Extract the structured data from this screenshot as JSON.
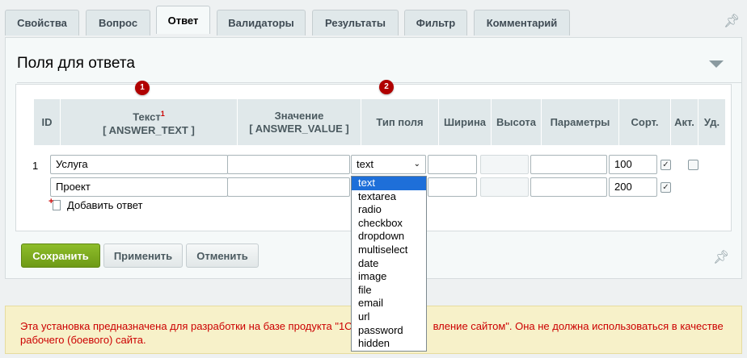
{
  "tabs": [
    "Свойства",
    "Вопрос",
    "Ответ",
    "Валидаторы",
    "Результаты",
    "Фильтр",
    "Комментарий"
  ],
  "panel": {
    "title": "Поля для ответа"
  },
  "badges": [
    "1",
    "2"
  ],
  "columns": {
    "id": "ID",
    "text": "Текст",
    "text_sub": "[ ANSWER_TEXT ]",
    "text_sup": "1",
    "value": "Значение",
    "value_sub": "[ ANSWER_VALUE ]",
    "field_type": "Тип поля",
    "width": "Ширина",
    "height": "Высота",
    "params": "Параметры",
    "sort": "Сорт.",
    "active": "Акт.",
    "delete": "Уд."
  },
  "rows": [
    {
      "id": "1",
      "text": "Услуга",
      "value": "",
      "field_type": "text",
      "sort": "100",
      "active": true,
      "delete": false
    },
    {
      "id": "",
      "text": "Проект",
      "value": "",
      "field_type": "",
      "sort": "200",
      "active": true,
      "delete": false
    }
  ],
  "add_answer": "Добавить ответ",
  "dropdown": {
    "selected": "text",
    "options": [
      "text",
      "textarea",
      "radio",
      "checkbox",
      "dropdown",
      "multiselect",
      "date",
      "image",
      "file",
      "email",
      "url",
      "password",
      "hidden"
    ]
  },
  "buttons": {
    "save": "Сохранить",
    "apply": "Применить",
    "cancel": "Отменить"
  },
  "warning": {
    "line1_start": "Эта установка предназначена для разработки на базе продукта \"1С",
    "line1_end": "вление сайтом\". Она не должна использоваться в качестве",
    "line2": "рабочего (боевого) сайта."
  },
  "icons": {
    "pin": "pin-icon",
    "collapse": "chevron-down-icon",
    "add": "add-document-icon"
  }
}
